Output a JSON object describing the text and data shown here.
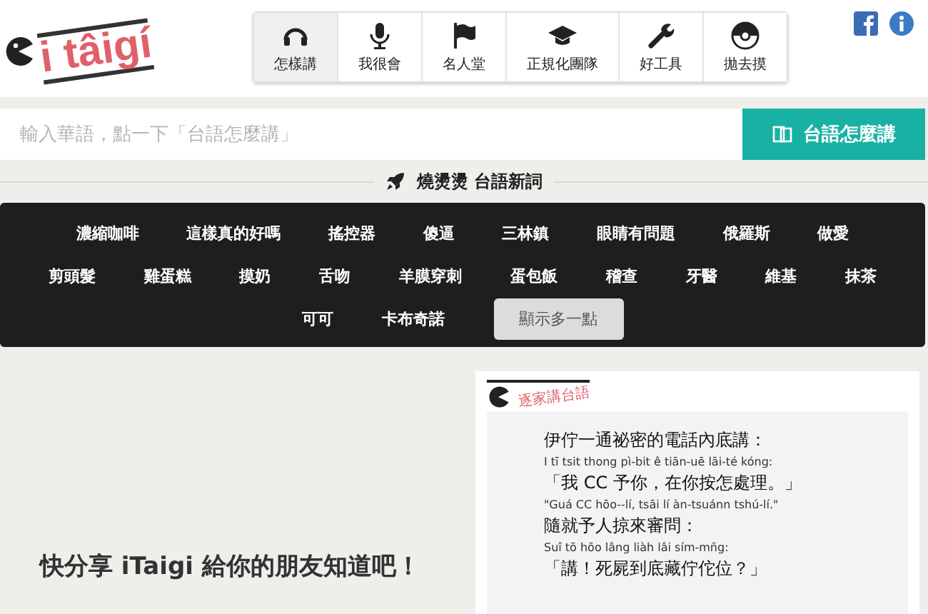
{
  "logo": {
    "text": "i tâigí"
  },
  "nav": [
    {
      "label": "怎樣講",
      "selected": true
    },
    {
      "label": "我很會",
      "selected": false
    },
    {
      "label": "名人堂",
      "selected": false
    },
    {
      "label": "正規化團隊",
      "selected": false
    },
    {
      "label": "好工具",
      "selected": false
    },
    {
      "label": "拋去摸",
      "selected": false
    }
  ],
  "search": {
    "placeholder": "輸入華語，點一下「台語怎麼講」",
    "button": "台語怎麼講"
  },
  "new_words": {
    "heading": "燒燙燙 台語新詞",
    "words": [
      "濃縮咖啡",
      "這樣真的好嗎",
      "搖控器",
      "傻逼",
      "三林鎮",
      "眼睛有問題",
      "俄羅斯",
      "做愛",
      "剪頭髮",
      "雞蛋糕",
      "摸奶",
      "舌吻",
      "羊膜穿刺",
      "蛋包飯",
      "稽查",
      "牙醫",
      "維基",
      "抹茶",
      "可可",
      "卡布奇諾"
    ],
    "more_button": "顯示多一點"
  },
  "share": {
    "text": "快分享 iTaigi 給你的朋友知道吧！"
  },
  "card": {
    "brand": "逐家講台語",
    "lines": [
      {
        "kind": "han",
        "text": "伊佇一通祕密的電話內底講："
      },
      {
        "kind": "roman",
        "text": "I tī tsit thong pì-bit ê tiān-uē lāi-té kóng:"
      },
      {
        "kind": "han",
        "text": "「我 CC 予你，在你按怎處理。」"
      },
      {
        "kind": "roman",
        "text": "\"Guá CC hōo--lí, tsāi lí àn-tsuánn tshú-lí.\""
      },
      {
        "kind": "han",
        "text": "隨就予人掠來審問："
      },
      {
        "kind": "roman",
        "text": "Suî tō hōo lâng liàh lâi sím-mn̄g:"
      },
      {
        "kind": "han",
        "text": "「講！死屍到底藏佇佗位？」"
      }
    ]
  }
}
